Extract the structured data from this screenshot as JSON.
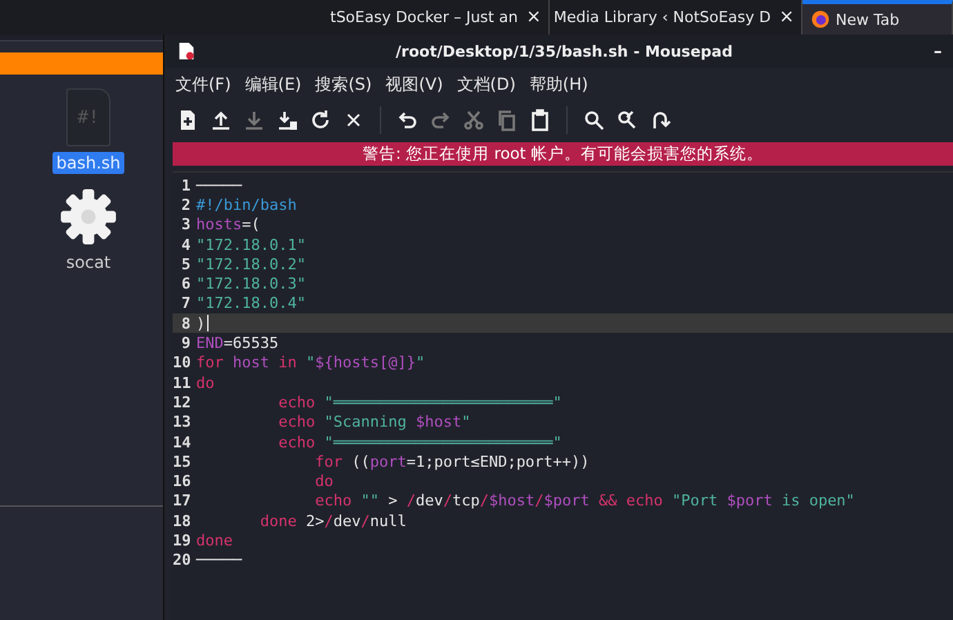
{
  "browser_tabs": [
    {
      "label": "tSoEasy Docker – Just an",
      "close": "×",
      "selected": false,
      "favicon": false
    },
    {
      "label": "Media Library ‹ NotSoEasy D",
      "close": "×",
      "selected": false,
      "favicon": false
    },
    {
      "label": "New Tab",
      "selected": true,
      "favicon": true
    }
  ],
  "desktop": {
    "icons": [
      {
        "kind": "script",
        "glyph": "#!",
        "label": "bash.sh",
        "selected": true
      },
      {
        "kind": "gear",
        "label": "socat",
        "selected": false
      }
    ]
  },
  "window": {
    "title": "/root/Desktop/1/35/bash.sh - Mousepad",
    "minimize": "–",
    "menu": [
      "文件(F)",
      "编辑(E)",
      "搜索(S)",
      "视图(V)",
      "文档(D)",
      "帮助(H)"
    ],
    "toolbar": [
      {
        "kind": "new",
        "disabled": false
      },
      {
        "kind": "upload",
        "disabled": false
      },
      {
        "kind": "download",
        "disabled": true
      },
      {
        "kind": "save-as",
        "disabled": false
      },
      {
        "kind": "reload",
        "disabled": false
      },
      {
        "kind": "close",
        "disabled": false
      },
      {
        "kind": "sep"
      },
      {
        "kind": "undo",
        "disabled": false
      },
      {
        "kind": "redo",
        "disabled": true
      },
      {
        "kind": "cut",
        "disabled": true
      },
      {
        "kind": "copy",
        "disabled": true
      },
      {
        "kind": "paste",
        "disabled": false
      },
      {
        "kind": "sep"
      },
      {
        "kind": "search",
        "disabled": false
      },
      {
        "kind": "replace",
        "disabled": false
      },
      {
        "kind": "jump",
        "disabled": false
      }
    ],
    "warning": "警告: 您正在使用 root 帐户。有可能会损害您的系统。"
  },
  "editor": {
    "lines": [
      {
        "number": "1",
        "current": false,
        "tokens": [
          {
            "kind": "plain",
            "text": "─────"
          }
        ]
      },
      {
        "number": "2",
        "current": false,
        "tokens": [
          {
            "kind": "comment",
            "text": "#!/bin/bash"
          }
        ]
      },
      {
        "number": "3",
        "current": false,
        "tokens": [
          {
            "kind": "var",
            "text": "hosts"
          },
          {
            "kind": "plain",
            "text": "=("
          }
        ]
      },
      {
        "number": "4",
        "current": false,
        "tokens": [
          {
            "kind": "str",
            "text": "\"172.18.0.1\""
          }
        ]
      },
      {
        "number": "5",
        "current": false,
        "tokens": [
          {
            "kind": "str",
            "text": "\"172.18.0.2\""
          }
        ]
      },
      {
        "number": "6",
        "current": false,
        "tokens": [
          {
            "kind": "str",
            "text": "\"172.18.0.3\""
          }
        ]
      },
      {
        "number": "7",
        "current": false,
        "tokens": [
          {
            "kind": "str",
            "text": "\"172.18.0.4\""
          }
        ]
      },
      {
        "number": "8",
        "current": true,
        "tokens": [
          {
            "kind": "plain",
            "text": ")"
          }
        ]
      },
      {
        "number": "9",
        "current": false,
        "tokens": [
          {
            "kind": "var",
            "text": "END"
          },
          {
            "kind": "plain",
            "text": "=65535"
          }
        ]
      },
      {
        "number": "10",
        "current": false,
        "tokens": [
          {
            "kind": "kw",
            "text": "for "
          },
          {
            "kind": "var",
            "text": "host "
          },
          {
            "kind": "kw",
            "text": "in "
          },
          {
            "kind": "str",
            "text": "\""
          },
          {
            "kind": "var",
            "text": "${hosts[@]}"
          },
          {
            "kind": "str",
            "text": "\""
          }
        ]
      },
      {
        "number": "11",
        "current": false,
        "tokens": [
          {
            "kind": "kw",
            "text": "do"
          }
        ]
      },
      {
        "number": "12",
        "current": false,
        "tokens": [
          {
            "kind": "kw",
            "text": "         echo "
          },
          {
            "kind": "str",
            "text": "\"════════════════════════\""
          }
        ]
      },
      {
        "number": "13",
        "current": false,
        "tokens": [
          {
            "kind": "kw",
            "text": "         echo "
          },
          {
            "kind": "str",
            "text": "\"Scanning "
          },
          {
            "kind": "var",
            "text": "$host"
          },
          {
            "kind": "str",
            "text": "\""
          }
        ]
      },
      {
        "number": "14",
        "current": false,
        "tokens": [
          {
            "kind": "kw",
            "text": "         echo "
          },
          {
            "kind": "str",
            "text": "\"════════════════════════\""
          }
        ]
      },
      {
        "number": "15",
        "current": false,
        "tokens": [
          {
            "kind": "kw",
            "text": "             for "
          },
          {
            "kind": "plain",
            "text": "(("
          },
          {
            "kind": "var",
            "text": "port"
          },
          {
            "kind": "plain",
            "text": "=1;port≤END;port++))"
          }
        ]
      },
      {
        "number": "16",
        "current": false,
        "tokens": [
          {
            "kind": "kw",
            "text": "             do"
          }
        ]
      },
      {
        "number": "17",
        "current": false,
        "tokens": [
          {
            "kind": "kw",
            "text": "             echo "
          },
          {
            "kind": "str",
            "text": "\"\""
          },
          {
            "kind": "plain",
            "text": " > "
          },
          {
            "kind": "kw",
            "text": "/"
          },
          {
            "kind": "plain",
            "text": "dev"
          },
          {
            "kind": "kw",
            "text": "/"
          },
          {
            "kind": "plain",
            "text": "tcp"
          },
          {
            "kind": "kw",
            "text": "/"
          },
          {
            "kind": "var",
            "text": "$host"
          },
          {
            "kind": "kw",
            "text": "/"
          },
          {
            "kind": "var",
            "text": "$port "
          },
          {
            "kind": "kw",
            "text": "&& echo "
          },
          {
            "kind": "str",
            "text": "\"Port "
          },
          {
            "kind": "var",
            "text": "$port"
          },
          {
            "kind": "str",
            "text": " is open\""
          }
        ]
      },
      {
        "number": "18",
        "current": false,
        "tokens": [
          {
            "kind": "kw",
            "text": "       done"
          },
          {
            "kind": "plain",
            "text": " 2>"
          },
          {
            "kind": "kw",
            "text": "/"
          },
          {
            "kind": "plain",
            "text": "dev"
          },
          {
            "kind": "kw",
            "text": "/"
          },
          {
            "kind": "plain",
            "text": "null"
          }
        ]
      },
      {
        "number": "19",
        "current": false,
        "tokens": [
          {
            "kind": "kw",
            "text": "done"
          }
        ]
      },
      {
        "number": "20",
        "current": false,
        "tokens": [
          {
            "kind": "plain",
            "text": "─────"
          }
        ]
      }
    ]
  }
}
